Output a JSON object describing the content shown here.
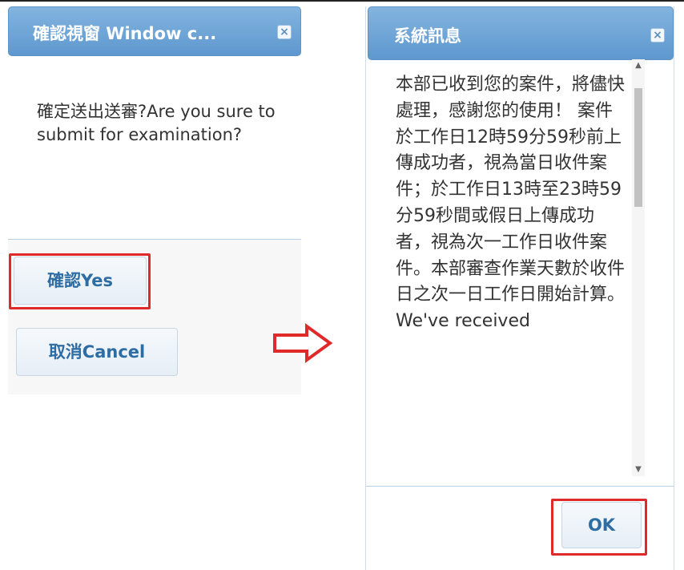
{
  "confirm_dialog": {
    "title": "確認視窗 Window c...",
    "message": "確定送出送審?Are you sure to submit for examination?",
    "yes_label": "確認Yes",
    "cancel_label": "取消Cancel"
  },
  "info_dialog": {
    "title": "系統訊息",
    "message": "本部已收到您的案件，將儘快處理，感謝您的使用！ 案件於工作日12時59分59秒前上傳成功者，視為當日收件案件；於工作日13時至23時59分59秒間或假日上傳成功者，視為次一工作日收件案件。本部審查作業天數於收件日之次一日工作日開始計算。We've received",
    "ok_label": "OK"
  },
  "icons": {
    "close": "close-icon",
    "arrow": "right-arrow-icon"
  },
  "colors": {
    "titlebar": "#6fa6d8",
    "button_text": "#2e6da4",
    "highlight": "#e02a2a"
  }
}
